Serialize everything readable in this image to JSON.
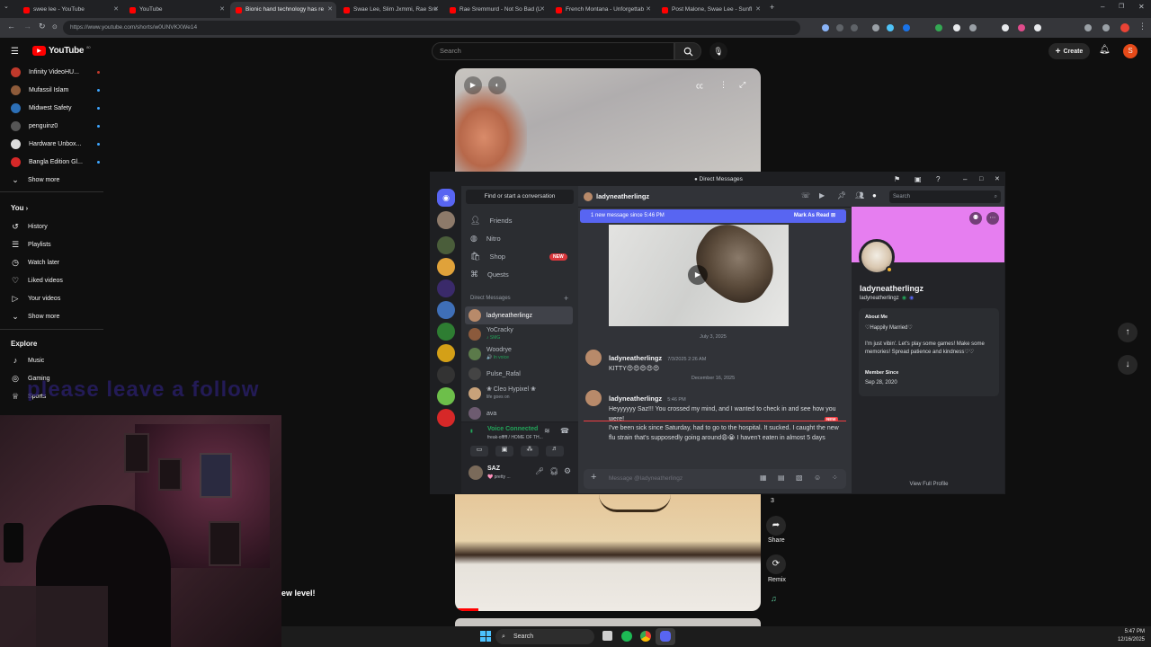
{
  "browser": {
    "tabs": [
      {
        "label": "swee lee - YouTube"
      },
      {
        "label": "YouTube"
      },
      {
        "label": "Bionic hand technology has re"
      },
      {
        "label": "Swae Lee, Slim Jxmmi, Rae Sre"
      },
      {
        "label": "Rae Sremmurd - Not So Bad (L"
      },
      {
        "label": "French Montana - Unforgettab"
      },
      {
        "label": "Post Malone, Swae Lee - Sunfl"
      }
    ],
    "url": "https://www.youtube.com/shorts/w0UNVKXWe14"
  },
  "youtube": {
    "logo_text": "YouTube",
    "logo_sup": "80",
    "search_placeholder": "Search",
    "create_label": "Create",
    "account_initial": "S",
    "subscriptions": [
      {
        "label": "Infinity VideoHU...",
        "color": "#c0392b"
      },
      {
        "label": "Mufassil Islam",
        "color": "#8e5b3a"
      },
      {
        "label": "Midwest Safety",
        "color": "#2c6fb7"
      },
      {
        "label": "penguinz0",
        "color": "#555555"
      },
      {
        "label": "Hardware Unbox...",
        "color": "#dddddd"
      },
      {
        "label": "Bangla Edition Gl...",
        "color": "#d62828"
      }
    ],
    "show_more": "Show more",
    "you_heading": "You",
    "you_items": [
      {
        "label": "History",
        "icon": "history-icon",
        "glyph": "↺"
      },
      {
        "label": "Playlists",
        "icon": "playlists-icon",
        "glyph": "☰"
      },
      {
        "label": "Watch later",
        "icon": "clock-icon",
        "glyph": "◷"
      },
      {
        "label": "Liked videos",
        "icon": "thumb-up-icon",
        "glyph": "♡"
      },
      {
        "label": "Your videos",
        "icon": "video-icon",
        "glyph": "▷"
      }
    ],
    "show_more_2": "Show more",
    "explore_heading": "Explore",
    "explore_items": [
      {
        "label": "Music",
        "icon": "music-icon",
        "glyph": "♪"
      },
      {
        "label": "Gaming",
        "icon": "gaming-icon",
        "glyph": "◎"
      },
      {
        "label": "Sports",
        "icon": "trophy-icon",
        "glyph": "🏆"
      }
    ],
    "overlay_text": "please leave a follow",
    "new_level_text": "ew level!",
    "short_actions": {
      "count": "3",
      "share": "Share",
      "remix": "Remix"
    }
  },
  "discord": {
    "window_title": "Direct Messages",
    "find_placeholder": "Find or start a conversation",
    "nav": [
      {
        "label": "Friends",
        "icon": "friends-icon"
      },
      {
        "label": "Nitro",
        "icon": "nitro-icon"
      },
      {
        "label": "Shop",
        "icon": "shop-icon",
        "badge": "NEW"
      },
      {
        "label": "Quests",
        "icon": "quests-icon"
      }
    ],
    "dm_heading": "Direct Messages",
    "dms": [
      {
        "name": "ladyneatherlingz",
        "sub": "",
        "color": "#b88a6a"
      },
      {
        "name": "YoCracky",
        "sub": "♪ SMG",
        "color": "#8b5a3c"
      },
      {
        "name": "Woodrye",
        "sub": "🔊 In voice",
        "color": "#5b7a4a"
      },
      {
        "name": "Pulse_Rafal",
        "sub": "",
        "color": "#444444"
      },
      {
        "name": "❀ Cleo Hypixel ❀",
        "sub": "life goes on",
        "color": "#c8a27a"
      },
      {
        "name": "ava",
        "sub": "",
        "color": "#6d5b70"
      }
    ],
    "voice": {
      "status": "Voice Connected",
      "channel": "freak-offfff / HOME OF TH..."
    },
    "user": {
      "name": "SAZ",
      "status": "🩷 pretty ..."
    },
    "chat": {
      "channel_name": "ladyneatherlingz",
      "search_placeholder": "Search",
      "new_msg_banner": "1 new message since 5:46 PM",
      "mark_read": "Mark As Read",
      "date1": "July 3, 2025",
      "msg1_name": "ladyneatherlingz",
      "msg1_time": "7/3/2025 2:26 AM",
      "msg1_text": "KITTY😍😍😍😍😍",
      "date2": "December 16, 2025",
      "msg2_name": "ladyneatherlingz",
      "msg2_time": "5:46 PM",
      "msg2_text": "Heyyyyyy Saz!!! You crossed my mind, and I wanted to check in and see how you were!",
      "new_label": "NEW",
      "msg3_text": "I've been sick since Saturday, had to go to the hospital. It sucked. I caught the new flu strain that's supposedly going around😩😭 I haven't eaten in almost 5 days",
      "input_placeholder": "Message @ladyneatherlingz"
    },
    "profile": {
      "display_name": "ladyneatherlingz",
      "username": "ladyneatherlingz",
      "about_heading": "About Me",
      "about_line1": "♡Happily Married♡",
      "about_line2": "I'm just vibin'. Let's play some games! Make some memories! Spread patience and kindness♡♡",
      "member_since_heading": "Member Since",
      "member_since": "Sep 28, 2020",
      "view_full": "View Full Profile",
      "banner_color": "#e67ef0"
    }
  },
  "taskbar": {
    "search_label": "Search",
    "time": "5:47 PM",
    "date": "12/16/2025"
  }
}
